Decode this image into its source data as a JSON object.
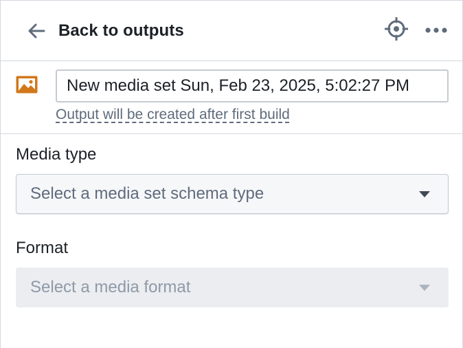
{
  "header": {
    "back_label": "Back to outputs",
    "back_icon": "arrow-left-icon",
    "locate_icon": "locate-icon",
    "more_icon": "more-horizontal-icon"
  },
  "output": {
    "icon": "media-image-icon",
    "icon_color": "#d1781b",
    "name_value": "New media set Sun, Feb 23, 2025, 5:02:27 PM",
    "note": "Output will be created after first build"
  },
  "media_type": {
    "label": "Media type",
    "placeholder": "Select a media set schema type"
  },
  "format": {
    "label": "Format",
    "placeholder": "Select a media format",
    "disabled": true
  }
}
